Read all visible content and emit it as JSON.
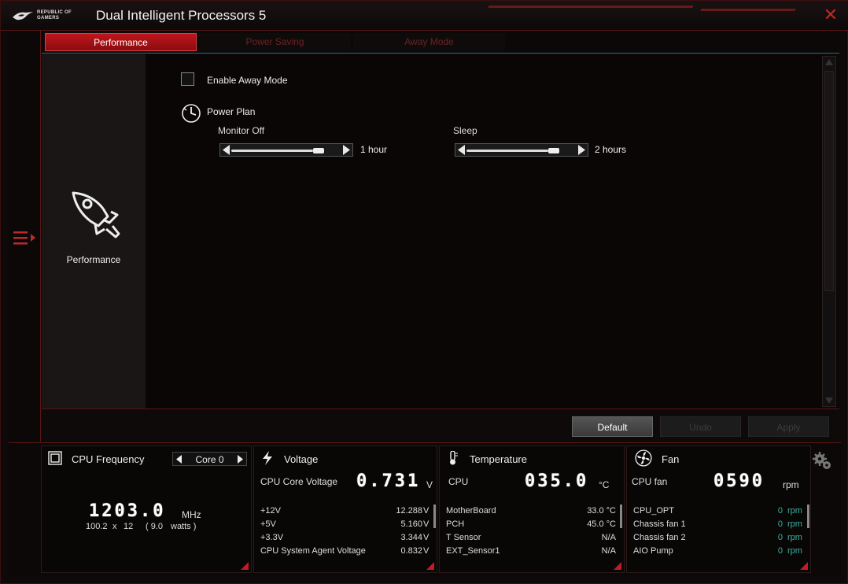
{
  "window": {
    "title": "Dual Intelligent Processors 5",
    "logo_text": "REPUBLIC OF GAMERS"
  },
  "tabs": [
    {
      "label": "Performance",
      "active": true
    },
    {
      "label": "Power Saving",
      "active": false
    },
    {
      "label": "Away Mode",
      "active": false
    }
  ],
  "side": {
    "mode_label": "Performance"
  },
  "away": {
    "enable_label": "Enable Away Mode",
    "enabled": false,
    "power_plan_label": "Power Plan",
    "monitor_off": {
      "label": "Monitor Off",
      "value": "1 hour"
    },
    "sleep": {
      "label": "Sleep",
      "value": "2 hours"
    }
  },
  "actions": {
    "default": "Default",
    "undo": "Undo",
    "apply": "Apply"
  },
  "monitor": {
    "cpu": {
      "title": "CPU Frequency",
      "core": "Core 0",
      "freq": "1203.0",
      "freq_unit": "MHz",
      "bclk": "100.2",
      "x": "x",
      "ratio": "12",
      "watts_value": "( 9.0",
      "watts_label": "watts )"
    },
    "voltage": {
      "title": "Voltage",
      "main_label": "CPU Core Voltage",
      "main_value": "0.731",
      "main_unit": "V",
      "rows": [
        {
          "name": "+12V",
          "value": "12.288",
          "unit": "V"
        },
        {
          "name": "+5V",
          "value": "5.160",
          "unit": "V"
        },
        {
          "name": "+3.3V",
          "value": "3.344",
          "unit": "V"
        },
        {
          "name": "CPU System Agent Voltage",
          "value": "0.832",
          "unit": "V"
        }
      ]
    },
    "temperature": {
      "title": "Temperature",
      "main_label": "CPU",
      "main_value": "035.0",
      "main_unit": "°C",
      "rows": [
        {
          "name": "MotherBoard",
          "value": "33.0 °C"
        },
        {
          "name": "PCH",
          "value": "45.0 °C"
        },
        {
          "name": "T Sensor",
          "value": "N/A"
        },
        {
          "name": "EXT_Sensor1",
          "value": "N/A"
        }
      ]
    },
    "fan": {
      "title": "Fan",
      "main_label": "CPU fan",
      "main_value": "0590",
      "main_unit": "rpm",
      "rows": [
        {
          "name": "CPU_OPT",
          "value": "0",
          "unit": "rpm"
        },
        {
          "name": "Chassis fan 1",
          "value": "0",
          "unit": "rpm"
        },
        {
          "name": "Chassis fan 2",
          "value": "0",
          "unit": "rpm"
        },
        {
          "name": "AIO Pump",
          "value": "0",
          "unit": "rpm"
        }
      ]
    }
  },
  "colors": {
    "accent": "#c0161c",
    "tab_underline": "#1f6f8a",
    "fan_value": "#3ab0a0"
  }
}
